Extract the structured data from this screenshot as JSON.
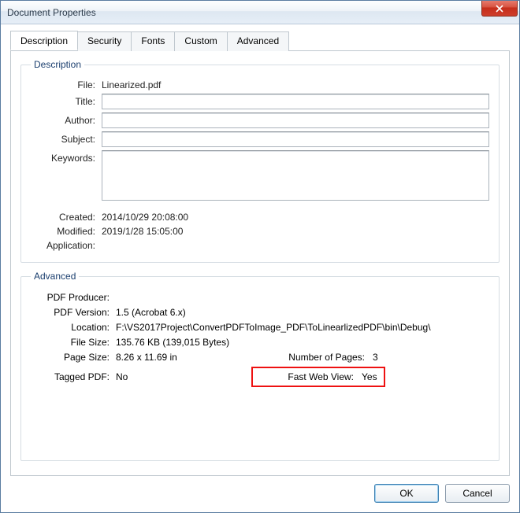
{
  "window": {
    "title": "Document Properties"
  },
  "tabs": {
    "description": "Description",
    "security": "Security",
    "fonts": "Fonts",
    "custom": "Custom",
    "advanced": "Advanced"
  },
  "groups": {
    "description_legend": "Description",
    "advanced_legend": "Advanced"
  },
  "desc": {
    "file_label": "File:",
    "file_value": "Linearized.pdf",
    "title_label": "Title:",
    "title_value": "",
    "author_label": "Author:",
    "author_value": "",
    "subject_label": "Subject:",
    "subject_value": "",
    "keywords_label": "Keywords:",
    "keywords_value": "",
    "created_label": "Created:",
    "created_value": "2014/10/29 20:08:00",
    "modified_label": "Modified:",
    "modified_value": "2019/1/28 15:05:00",
    "application_label": "Application:",
    "application_value": ""
  },
  "adv": {
    "producer_label": "PDF Producer:",
    "producer_value": "",
    "version_label": "PDF Version:",
    "version_value": "1.5 (Acrobat 6.x)",
    "location_label": "Location:",
    "location_value": "F:\\VS2017Project\\ConvertPDFToImage_PDF\\ToLinearlizedPDF\\bin\\Debug\\",
    "filesize_label": "File Size:",
    "filesize_value": "135.76 KB (139,015 Bytes)",
    "pagesize_label": "Page Size:",
    "pagesize_value": "8.26 x 11.69 in",
    "numpages_label": "Number of Pages:",
    "numpages_value": "3",
    "tagged_label": "Tagged PDF:",
    "tagged_value": "No",
    "fastweb_label": "Fast Web View:",
    "fastweb_value": "Yes"
  },
  "buttons": {
    "ok": "OK",
    "cancel": "Cancel"
  }
}
